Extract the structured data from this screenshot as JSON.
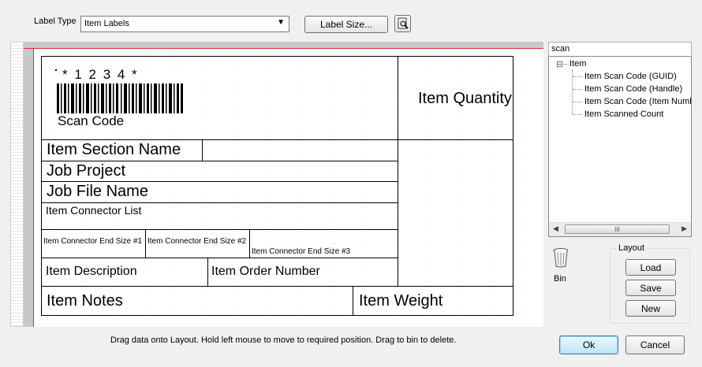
{
  "toolbar": {
    "label_type_caption": "Label Type",
    "label_type_value": "Item Labels",
    "label_size_button": "Label Size..."
  },
  "label": {
    "barcode_text": "* 1 2 3 4 *",
    "scan_code": "Scan Code",
    "item_quantity": "Item Quantity",
    "item_section_name": "Item Section Name",
    "job_project": "Job Project",
    "job_file_name": "Job File Name",
    "item_connector_list": "Item Connector List",
    "connector_end_1": "Item Connector End Size #1",
    "connector_end_2": "Item Connector End Size #2",
    "connector_end_3": "Item Connector End Size #3",
    "item_description": "Item Description",
    "item_order_number": "Item Order Number",
    "item_notes": "Item Notes",
    "item_weight": "Item Weight"
  },
  "search": {
    "value": "scan"
  },
  "tree": {
    "root": "Item",
    "expander": "⊟",
    "children": [
      "Item Scan Code (GUID)",
      "Item Scan Code (Handle)",
      "Item Scan Code (Item Numb",
      "Item Scanned Count"
    ]
  },
  "hscroll": {
    "grip": "III"
  },
  "bin": {
    "label": "Bin"
  },
  "layout_group": {
    "title": "Layout",
    "load": "Load",
    "save": "Save",
    "new": "New"
  },
  "status_hint": "Drag data onto Layout. Hold left mouse to move to required position. Drag to bin to delete.",
  "dialog": {
    "ok": "Ok",
    "cancel": "Cancel"
  },
  "colors": {
    "accent_red": "#e0303a",
    "canvas_gray": "#c8c8c8"
  }
}
